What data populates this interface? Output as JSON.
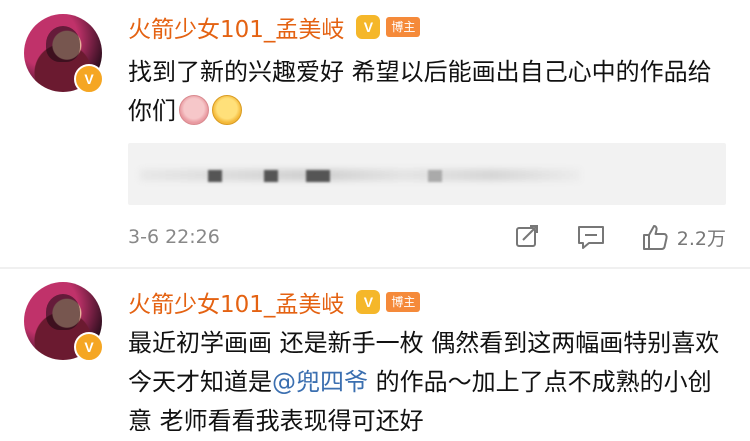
{
  "posts": [
    {
      "username": "火箭少女101_孟美岐",
      "vip_badge": "V",
      "tag": "博主",
      "verified": "V",
      "content": "找到了新的兴趣爱好 希望以后能画出自己心中的作品给你们",
      "emojis": [
        "pig-emoji",
        "smile-heart-emoji"
      ],
      "timestamp": "3-6 22:26",
      "likes": "2.2万"
    },
    {
      "username": "火箭少女101_孟美岐",
      "vip_badge": "V",
      "tag": "博主",
      "verified": "V",
      "content_before": "最近初学画画 还是新手一枚 偶然看到这两幅画特别喜欢 今天才知道是",
      "mention": "@兜四爷",
      "content_after": " 的作品～加上了点不成熟的小创意 老师看看我表现得可还好"
    }
  ],
  "colors": {
    "username": "#e46212",
    "mention": "#3b6fb0",
    "tag_bg": "#f58a3a",
    "vip_bg": "#f5b72a"
  }
}
